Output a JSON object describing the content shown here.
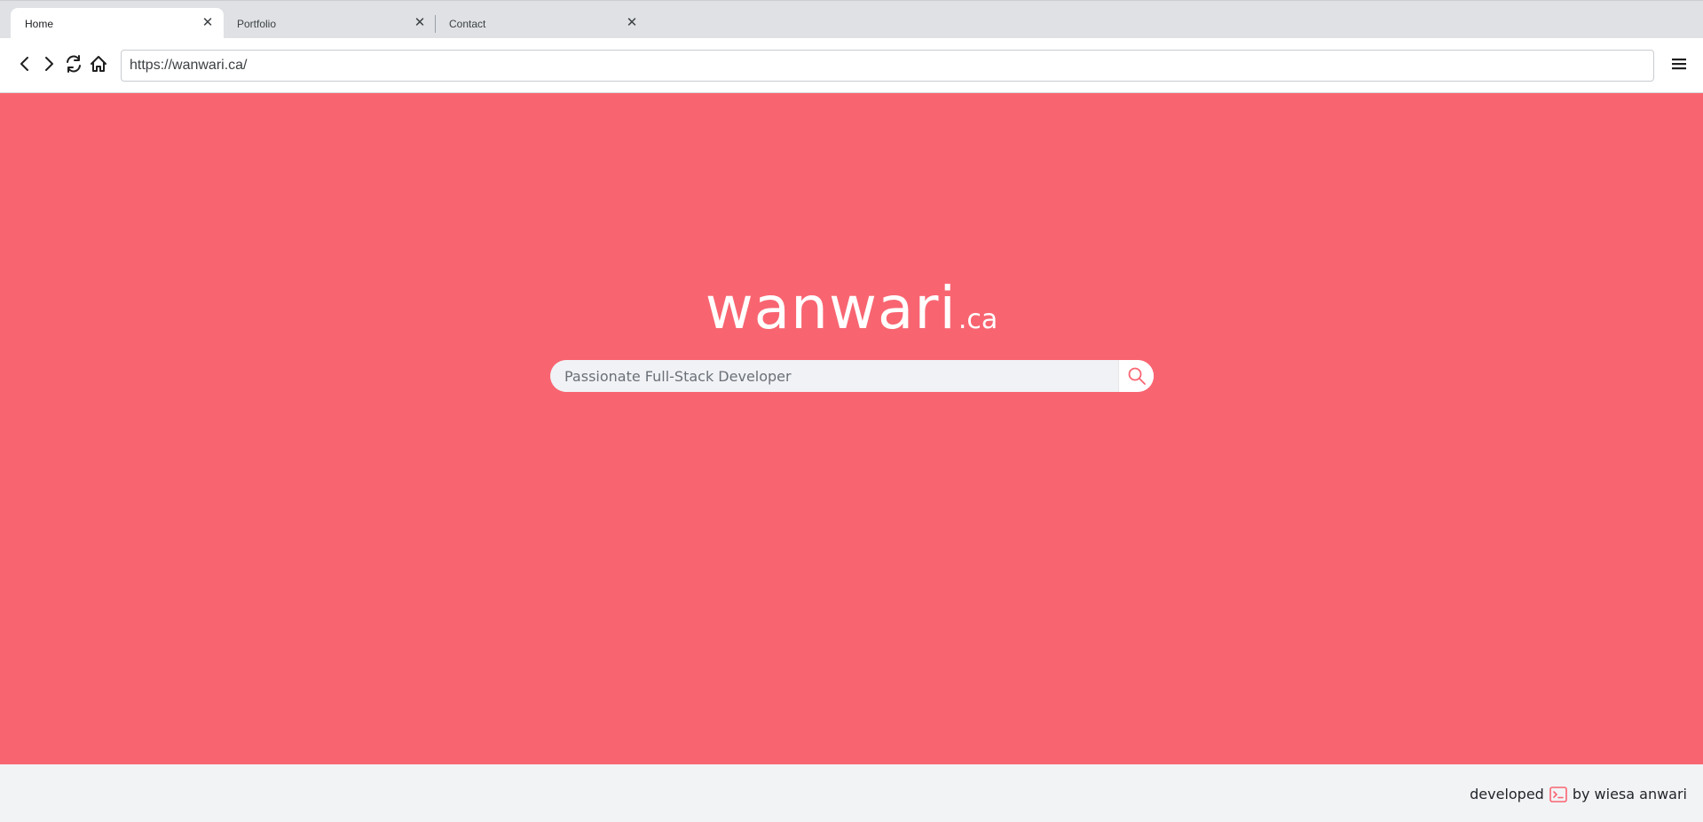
{
  "browser": {
    "tabs": [
      {
        "title": "Home",
        "active": true
      },
      {
        "title": "Portfolio",
        "active": false
      },
      {
        "title": "Contact",
        "active": false
      }
    ],
    "tab_close_glyph": "✕",
    "address": {
      "url": "https://wanwari.ca/"
    },
    "icons": {
      "back": "back-arrow-icon",
      "forward": "forward-arrow-icon",
      "reload": "reload-icon",
      "home": "home-icon",
      "menu": "hamburger-menu-icon"
    }
  },
  "page": {
    "logo": {
      "name": "wanwari",
      "tld": ".ca"
    },
    "search": {
      "placeholder": "Passionate Full-Stack Developer",
      "icon": "search-icon"
    },
    "footer": {
      "text_before": "developed",
      "icon": "terminal-icon",
      "text_after": "by wiesa anwari"
    }
  },
  "colors": {
    "hero_background": "#f86571",
    "accent": "#f86571",
    "footer_background": "#f2f3f5",
    "logo_text": "#ffffff"
  }
}
